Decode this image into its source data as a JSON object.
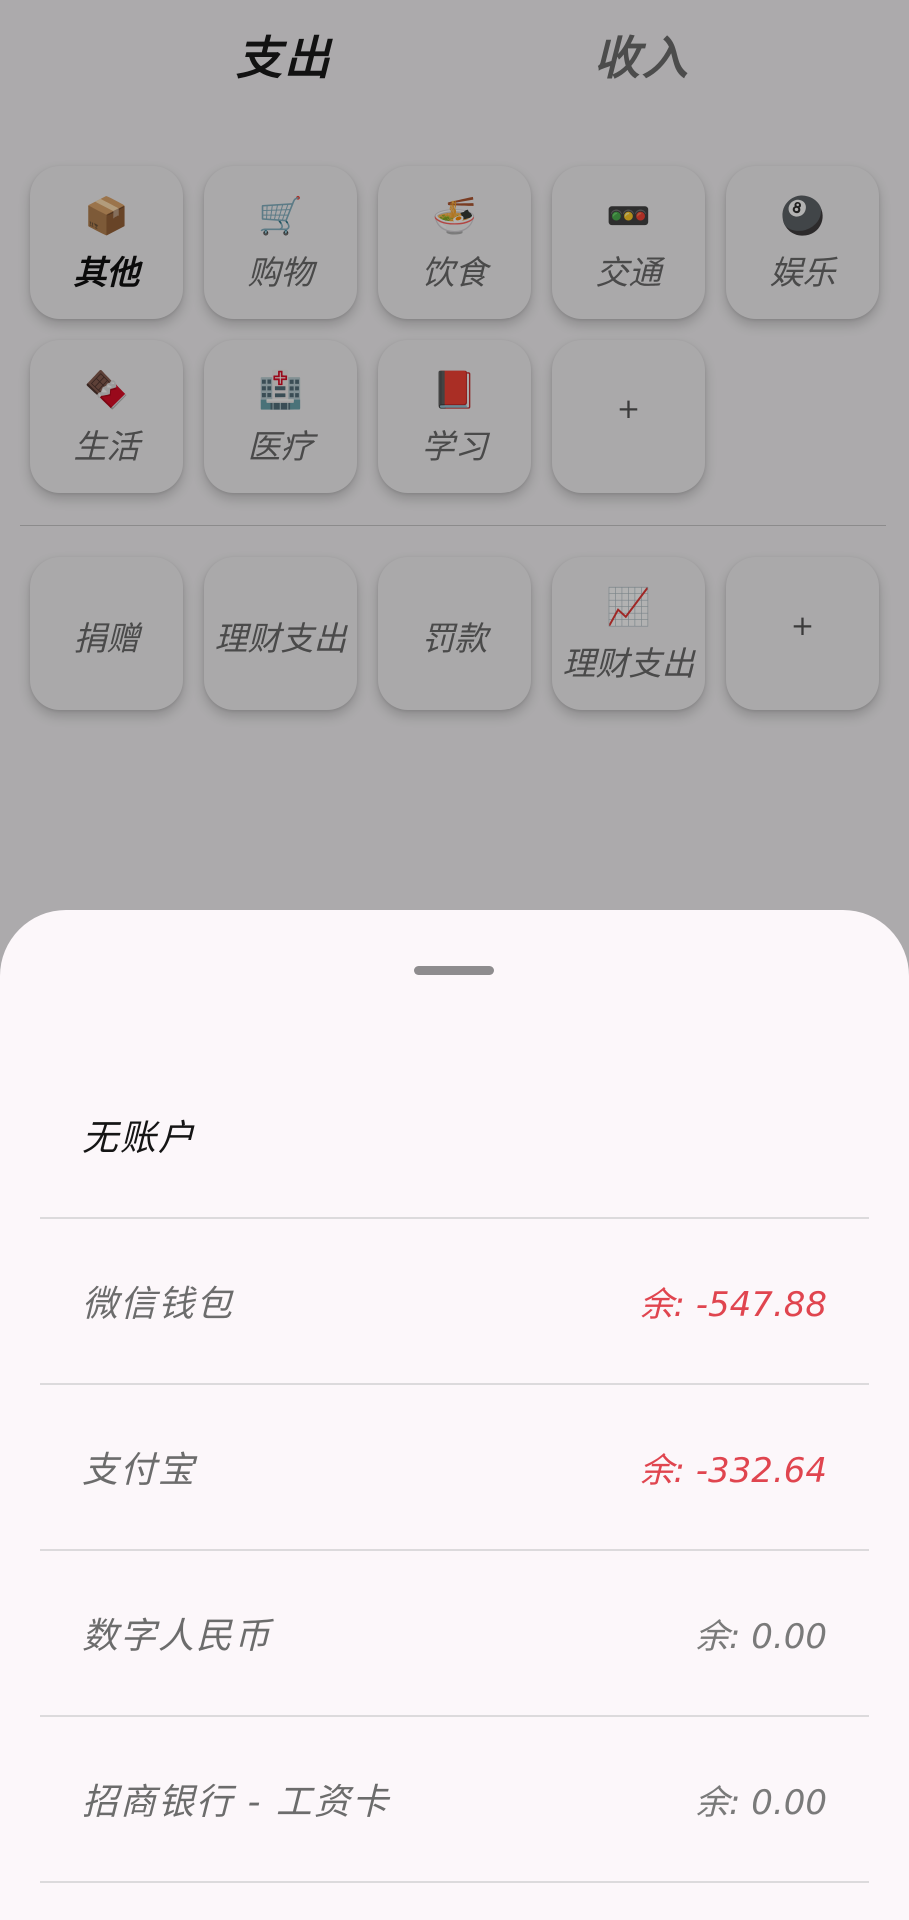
{
  "tabs": {
    "expense": "支出",
    "income": "收入"
  },
  "categories": [
    {
      "icon": "📦",
      "label": "其他",
      "selected": true
    },
    {
      "icon": "🛒",
      "label": "购物"
    },
    {
      "icon": "🍜",
      "label": "饮食"
    },
    {
      "icon": "🚥",
      "label": "交通"
    },
    {
      "icon": "🎱",
      "label": "娱乐"
    },
    {
      "icon": "🍫",
      "label": "生活"
    },
    {
      "icon": "🏥",
      "label": "医疗"
    },
    {
      "icon": "📕",
      "label": "学习"
    },
    {
      "add": "+"
    }
  ],
  "sub_categories": [
    {
      "label": "捐赠"
    },
    {
      "label": "理财支出"
    },
    {
      "label": "罚款"
    },
    {
      "icon": "📈",
      "label": "理财支出"
    },
    {
      "add": "+"
    }
  ],
  "accounts": {
    "none": "无账户",
    "items": [
      {
        "name": "微信钱包",
        "balance": "余: -547.88",
        "color": "#e0454f"
      },
      {
        "name": "支付宝",
        "balance": "余: -332.64",
        "color": "#e0454f"
      },
      {
        "name": "数字人民币",
        "balance": "余: 0.00",
        "color": "#7a7a7a"
      },
      {
        "name": "招商银行 - 工资卡",
        "balance": "余: 0.00",
        "color": "#7a7a7a"
      }
    ]
  }
}
